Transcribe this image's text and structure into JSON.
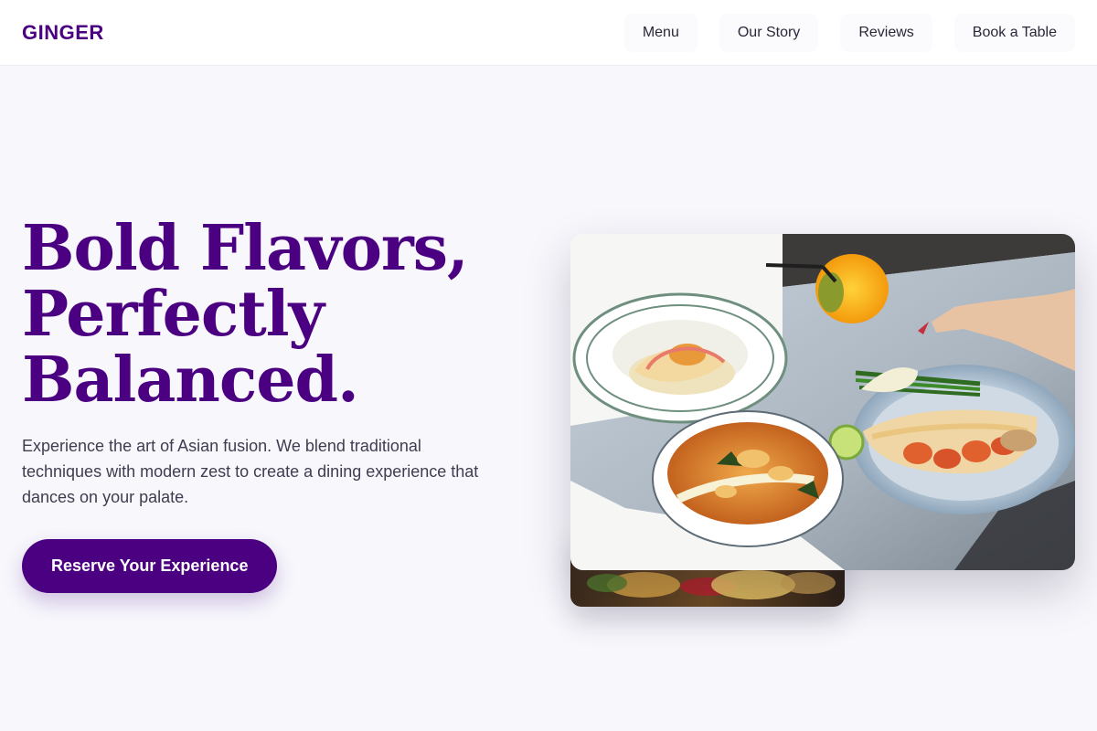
{
  "brand": {
    "name": "GINGER",
    "color": "#4b0082"
  },
  "nav": {
    "items": [
      {
        "label": "Menu"
      },
      {
        "label": "Our Story"
      },
      {
        "label": "Reviews"
      },
      {
        "label": "Book a Table"
      }
    ]
  },
  "hero": {
    "title_lines": [
      "Bold Flavors,",
      "Perfectly",
      "Balanced."
    ],
    "description": "Experience the art of Asian fusion. We blend traditional techniques with modern zest to create a dining experience that dances on your palate.",
    "cta_label": "Reserve Your Experience"
  },
  "images": {
    "main": {
      "icon": "food-photo"
    },
    "secondary": {
      "icon": "food-photo"
    }
  },
  "colors": {
    "accent": "#4b0082",
    "background": "#f7f7fc",
    "header_bg": "#ffffff",
    "text_body": "#3f3d4f"
  }
}
